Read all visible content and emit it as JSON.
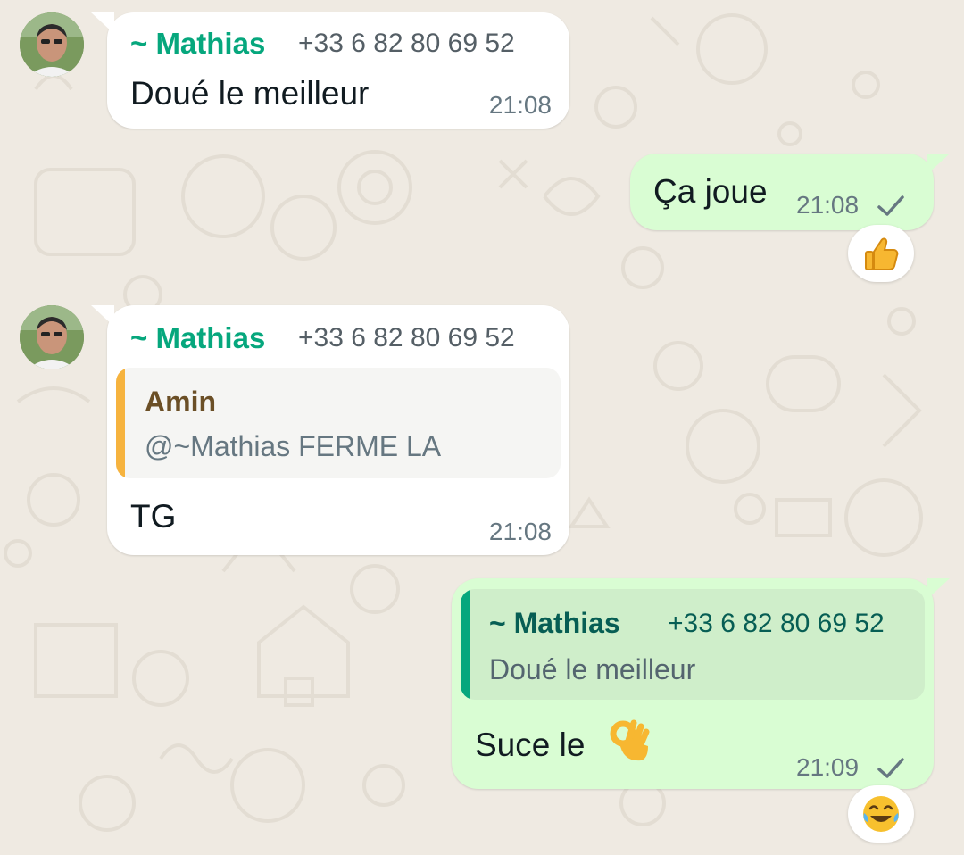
{
  "messages": [
    {
      "sender": "~ Mathias",
      "phone": "+33 6 82 80 69 52",
      "text": "Doué le meilleur",
      "time": "21:08"
    },
    {
      "text": "Ça joue",
      "time": "21:08",
      "status_icon": "single-check-icon",
      "reaction": "thumbs-up-emoji"
    },
    {
      "sender": "~ Mathias",
      "phone": "+33 6 82 80 69 52",
      "quote": {
        "author": "Amin",
        "text": "@~Mathias FERME LA",
        "accent": "#f6b33e"
      },
      "text": "TG",
      "time": "21:08"
    },
    {
      "quote": {
        "author": "~ Mathias",
        "phone": "+33 6 82 80 69 52",
        "text": "Doué le meilleur",
        "accent": "#06a77d"
      },
      "text": "Suce le",
      "emoji": "ok-hand-emoji",
      "time": "21:09",
      "status_icon": "single-check-icon",
      "reaction": "laughing-tears-emoji"
    }
  ],
  "colors": {
    "background": "#efeae2",
    "incoming_bubble": "#ffffff",
    "outgoing_bubble": "#d9fdd3",
    "sender_name": "#06a77d"
  }
}
